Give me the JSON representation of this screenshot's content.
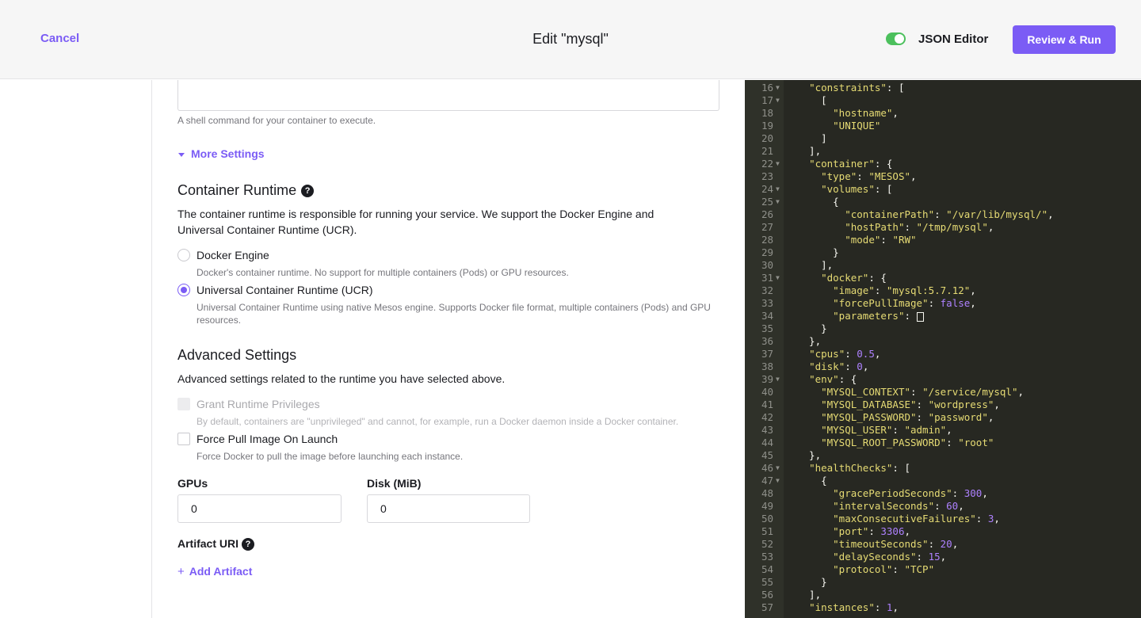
{
  "header": {
    "cancel_label": "Cancel",
    "title": "Edit \"mysql\"",
    "json_editor_label": "JSON Editor",
    "json_editor_enabled": true,
    "review_run_label": "Review & Run",
    "accent_color": "#7b5cf5",
    "toggle_color": "#4cc05d"
  },
  "form": {
    "command_help": "A shell command for your container to execute.",
    "more_settings_label": "More Settings",
    "container_runtime": {
      "heading": "Container Runtime",
      "help_icon": "question-circle-icon",
      "description": "The container runtime is responsible for running your service. We support the Docker Engine and Universal Container Runtime (UCR).",
      "options": [
        {
          "label": "Docker Engine",
          "help": "Docker's container runtime. No support for multiple containers (Pods) or GPU resources.",
          "selected": false
        },
        {
          "label": "Universal Container Runtime (UCR)",
          "help": "Universal Container Runtime using native Mesos engine. Supports Docker file format, multiple containers (Pods) and GPU resources.",
          "selected": true
        }
      ]
    },
    "advanced_settings": {
      "heading": "Advanced Settings",
      "description": "Advanced settings related to the runtime you have selected above.",
      "checkboxes": [
        {
          "label": "Grant Runtime Privileges",
          "help": "By default, containers are \"unprivileged\" and cannot, for example, run a Docker daemon inside a Docker container.",
          "checked": false,
          "disabled": true
        },
        {
          "label": "Force Pull Image On Launch",
          "help": "Force Docker to pull the image before launching each instance.",
          "checked": false,
          "disabled": false
        }
      ],
      "gpus_label": "GPUs",
      "gpus_value": "0",
      "disk_label": "Disk (MiB)",
      "disk_value": "0",
      "artifact_uri_label": "Artifact URI",
      "add_artifact_label": "Add Artifact"
    }
  },
  "json_editor": {
    "lines": [
      {
        "n": "16",
        "fold": true,
        "tokens": [
          [
            "p",
            "  "
          ],
          [
            "k",
            "\"constraints\""
          ],
          [
            "p",
            ": ["
          ]
        ]
      },
      {
        "n": "17",
        "fold": true,
        "tokens": [
          [
            "p",
            "    ["
          ]
        ]
      },
      {
        "n": "18",
        "fold": false,
        "tokens": [
          [
            "p",
            "      "
          ],
          [
            "s",
            "\"hostname\""
          ],
          [
            "p",
            ","
          ]
        ]
      },
      {
        "n": "19",
        "fold": false,
        "tokens": [
          [
            "p",
            "      "
          ],
          [
            "s",
            "\"UNIQUE\""
          ]
        ]
      },
      {
        "n": "20",
        "fold": false,
        "tokens": [
          [
            "p",
            "    ]"
          ]
        ]
      },
      {
        "n": "21",
        "fold": false,
        "tokens": [
          [
            "p",
            "  ],"
          ]
        ]
      },
      {
        "n": "22",
        "fold": true,
        "tokens": [
          [
            "p",
            "  "
          ],
          [
            "k",
            "\"container\""
          ],
          [
            "p",
            ": {"
          ]
        ]
      },
      {
        "n": "23",
        "fold": false,
        "tokens": [
          [
            "p",
            "    "
          ],
          [
            "k",
            "\"type\""
          ],
          [
            "p",
            ": "
          ],
          [
            "s",
            "\"MESOS\""
          ],
          [
            "p",
            ","
          ]
        ]
      },
      {
        "n": "24",
        "fold": true,
        "tokens": [
          [
            "p",
            "    "
          ],
          [
            "k",
            "\"volumes\""
          ],
          [
            "p",
            ": ["
          ]
        ]
      },
      {
        "n": "25",
        "fold": true,
        "tokens": [
          [
            "p",
            "      {"
          ]
        ]
      },
      {
        "n": "26",
        "fold": false,
        "tokens": [
          [
            "p",
            "        "
          ],
          [
            "k",
            "\"containerPath\""
          ],
          [
            "p",
            ": "
          ],
          [
            "s",
            "\"/var/lib/mysql/\""
          ],
          [
            "p",
            ","
          ]
        ]
      },
      {
        "n": "27",
        "fold": false,
        "tokens": [
          [
            "p",
            "        "
          ],
          [
            "k",
            "\"hostPath\""
          ],
          [
            "p",
            ": "
          ],
          [
            "s",
            "\"/tmp/mysql\""
          ],
          [
            "p",
            ","
          ]
        ]
      },
      {
        "n": "28",
        "fold": false,
        "tokens": [
          [
            "p",
            "        "
          ],
          [
            "k",
            "\"mode\""
          ],
          [
            "p",
            ": "
          ],
          [
            "s",
            "\"RW\""
          ]
        ]
      },
      {
        "n": "29",
        "fold": false,
        "tokens": [
          [
            "p",
            "      }"
          ]
        ]
      },
      {
        "n": "30",
        "fold": false,
        "tokens": [
          [
            "p",
            "    ],"
          ]
        ]
      },
      {
        "n": "31",
        "fold": true,
        "tokens": [
          [
            "p",
            "    "
          ],
          [
            "k",
            "\"docker\""
          ],
          [
            "p",
            ": {"
          ]
        ]
      },
      {
        "n": "32",
        "fold": false,
        "tokens": [
          [
            "p",
            "      "
          ],
          [
            "k",
            "\"image\""
          ],
          [
            "p",
            ": "
          ],
          [
            "s",
            "\"mysql:5.7.12\""
          ],
          [
            "p",
            ","
          ]
        ]
      },
      {
        "n": "33",
        "fold": false,
        "tokens": [
          [
            "p",
            "      "
          ],
          [
            "k",
            "\"forcePullImage\""
          ],
          [
            "p",
            ": "
          ],
          [
            "b",
            "false"
          ],
          [
            "p",
            ","
          ]
        ]
      },
      {
        "n": "34",
        "fold": false,
        "tokens": [
          [
            "p",
            "      "
          ],
          [
            "k",
            "\"parameters\""
          ],
          [
            "p",
            ": "
          ],
          [
            "cursor",
            "[]"
          ]
        ]
      },
      {
        "n": "35",
        "fold": false,
        "tokens": [
          [
            "p",
            "    }"
          ]
        ]
      },
      {
        "n": "36",
        "fold": false,
        "tokens": [
          [
            "p",
            "  },"
          ]
        ]
      },
      {
        "n": "37",
        "fold": false,
        "tokens": [
          [
            "p",
            "  "
          ],
          [
            "k",
            "\"cpus\""
          ],
          [
            "p",
            ": "
          ],
          [
            "n",
            "0.5"
          ],
          [
            "p",
            ","
          ]
        ]
      },
      {
        "n": "38",
        "fold": false,
        "tokens": [
          [
            "p",
            "  "
          ],
          [
            "k",
            "\"disk\""
          ],
          [
            "p",
            ": "
          ],
          [
            "n",
            "0"
          ],
          [
            "p",
            ","
          ]
        ]
      },
      {
        "n": "39",
        "fold": true,
        "tokens": [
          [
            "p",
            "  "
          ],
          [
            "k",
            "\"env\""
          ],
          [
            "p",
            ": {"
          ]
        ]
      },
      {
        "n": "40",
        "fold": false,
        "tokens": [
          [
            "p",
            "    "
          ],
          [
            "k",
            "\"MYSQL_CONTEXT\""
          ],
          [
            "p",
            ": "
          ],
          [
            "s",
            "\"/service/mysql\""
          ],
          [
            "p",
            ","
          ]
        ]
      },
      {
        "n": "41",
        "fold": false,
        "tokens": [
          [
            "p",
            "    "
          ],
          [
            "k",
            "\"MYSQL_DATABASE\""
          ],
          [
            "p",
            ": "
          ],
          [
            "s",
            "\"wordpress\""
          ],
          [
            "p",
            ","
          ]
        ]
      },
      {
        "n": "42",
        "fold": false,
        "tokens": [
          [
            "p",
            "    "
          ],
          [
            "k",
            "\"MYSQL_PASSWORD\""
          ],
          [
            "p",
            ": "
          ],
          [
            "s",
            "\"password\""
          ],
          [
            "p",
            ","
          ]
        ]
      },
      {
        "n": "43",
        "fold": false,
        "tokens": [
          [
            "p",
            "    "
          ],
          [
            "k",
            "\"MYSQL_USER\""
          ],
          [
            "p",
            ": "
          ],
          [
            "s",
            "\"admin\""
          ],
          [
            "p",
            ","
          ]
        ]
      },
      {
        "n": "44",
        "fold": false,
        "tokens": [
          [
            "p",
            "    "
          ],
          [
            "k",
            "\"MYSQL_ROOT_PASSWORD\""
          ],
          [
            "p",
            ": "
          ],
          [
            "s",
            "\"root\""
          ]
        ]
      },
      {
        "n": "45",
        "fold": false,
        "tokens": [
          [
            "p",
            "  },"
          ]
        ]
      },
      {
        "n": "46",
        "fold": true,
        "tokens": [
          [
            "p",
            "  "
          ],
          [
            "k",
            "\"healthChecks\""
          ],
          [
            "p",
            ": ["
          ]
        ]
      },
      {
        "n": "47",
        "fold": true,
        "tokens": [
          [
            "p",
            "    {"
          ]
        ]
      },
      {
        "n": "48",
        "fold": false,
        "tokens": [
          [
            "p",
            "      "
          ],
          [
            "k",
            "\"gracePeriodSeconds\""
          ],
          [
            "p",
            ": "
          ],
          [
            "n",
            "300"
          ],
          [
            "p",
            ","
          ]
        ]
      },
      {
        "n": "49",
        "fold": false,
        "tokens": [
          [
            "p",
            "      "
          ],
          [
            "k",
            "\"intervalSeconds\""
          ],
          [
            "p",
            ": "
          ],
          [
            "n",
            "60"
          ],
          [
            "p",
            ","
          ]
        ]
      },
      {
        "n": "50",
        "fold": false,
        "tokens": [
          [
            "p",
            "      "
          ],
          [
            "k",
            "\"maxConsecutiveFailures\""
          ],
          [
            "p",
            ": "
          ],
          [
            "n",
            "3"
          ],
          [
            "p",
            ","
          ]
        ]
      },
      {
        "n": "51",
        "fold": false,
        "tokens": [
          [
            "p",
            "      "
          ],
          [
            "k",
            "\"port\""
          ],
          [
            "p",
            ": "
          ],
          [
            "n",
            "3306"
          ],
          [
            "p",
            ","
          ]
        ]
      },
      {
        "n": "52",
        "fold": false,
        "tokens": [
          [
            "p",
            "      "
          ],
          [
            "k",
            "\"timeoutSeconds\""
          ],
          [
            "p",
            ": "
          ],
          [
            "n",
            "20"
          ],
          [
            "p",
            ","
          ]
        ]
      },
      {
        "n": "53",
        "fold": false,
        "tokens": [
          [
            "p",
            "      "
          ],
          [
            "k",
            "\"delaySeconds\""
          ],
          [
            "p",
            ": "
          ],
          [
            "n",
            "15"
          ],
          [
            "p",
            ","
          ]
        ]
      },
      {
        "n": "54",
        "fold": false,
        "tokens": [
          [
            "p",
            "      "
          ],
          [
            "k",
            "\"protocol\""
          ],
          [
            "p",
            ": "
          ],
          [
            "s",
            "\"TCP\""
          ]
        ]
      },
      {
        "n": "55",
        "fold": false,
        "tokens": [
          [
            "p",
            "    }"
          ]
        ]
      },
      {
        "n": "56",
        "fold": false,
        "tokens": [
          [
            "p",
            "  ],"
          ]
        ]
      },
      {
        "n": "57",
        "fold": false,
        "tokens": [
          [
            "p",
            "  "
          ],
          [
            "k",
            "\"instances\""
          ],
          [
            "p",
            ": "
          ],
          [
            "n",
            "1"
          ],
          [
            "p",
            ","
          ]
        ]
      }
    ]
  }
}
